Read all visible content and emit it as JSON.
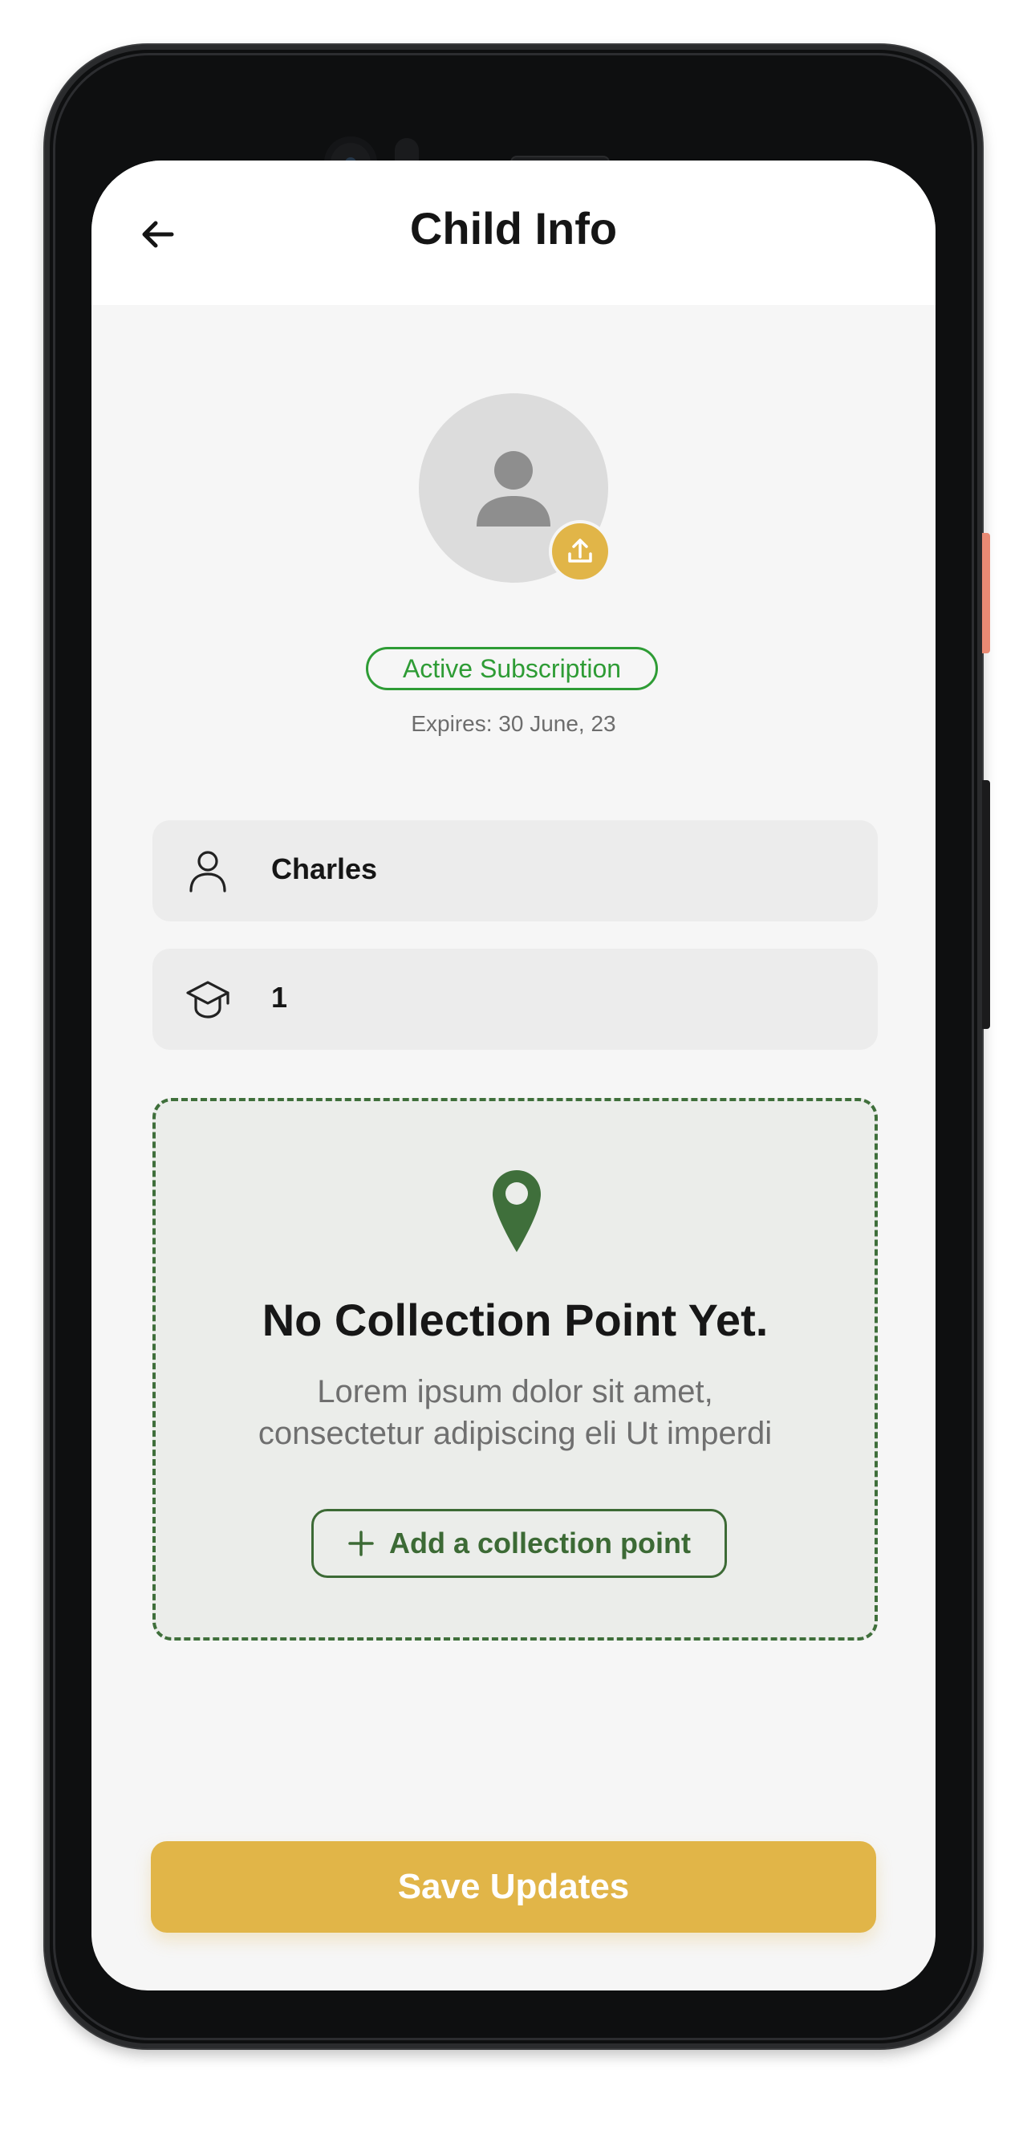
{
  "header": {
    "title": "Child Info"
  },
  "subscription": {
    "badge": "Active Subscription",
    "expires": "Expires: 30 June, 23"
  },
  "fields": {
    "name": "Charles",
    "grade": "1"
  },
  "collection": {
    "title": "No Collection Point Yet.",
    "description_line1": "Lorem ipsum dolor sit amet,",
    "description_line2": "consectetur adipiscing eli Ut imperdi",
    "add_button": "Add a collection point"
  },
  "footer": {
    "save_button": "Save Updates"
  },
  "colors": {
    "accent": "#e1b548",
    "green": "#3c6a35",
    "badge_green": "#2e9c35"
  },
  "icons": [
    "back-arrow-icon",
    "avatar-person-icon",
    "upload-icon",
    "person-icon",
    "graduation-cap-icon",
    "location-pin-icon",
    "plus-icon"
  ]
}
